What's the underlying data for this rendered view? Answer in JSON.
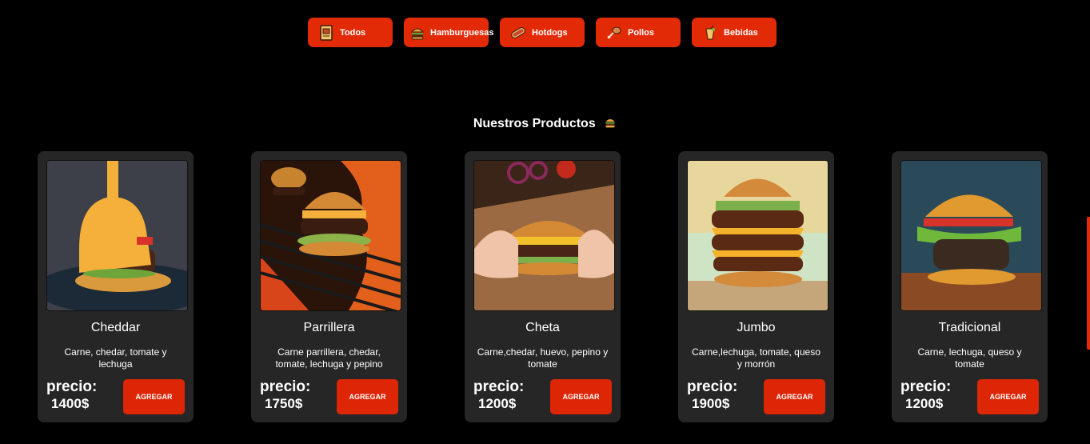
{
  "filters": [
    {
      "label": "Todos",
      "icon": "menu-book-icon"
    },
    {
      "label": "Hamburguesas",
      "icon": "burger-icon"
    },
    {
      "label": "Hotdogs",
      "icon": "hotdog-icon"
    },
    {
      "label": "Pollos",
      "icon": "chicken-leg-icon"
    },
    {
      "label": "Bebidas",
      "icon": "drink-icon"
    }
  ],
  "section": {
    "title": "Nuestros Productos",
    "icon": "burger-icon"
  },
  "products": [
    {
      "name": "Cheddar",
      "description": "Carne, chedar, tomate y lechuga",
      "price_label": "precio:",
      "price": "1400$",
      "button": "AGREGAR",
      "image": "cheddar-burger-image"
    },
    {
      "name": "Parrillera",
      "description": "Carne parrillera, chedar, tomate, lechuga y pepino",
      "price_label": "precio:",
      "price": "1750$",
      "button": "AGREGAR",
      "image": "grilled-burger-image"
    },
    {
      "name": "Cheta",
      "description": "Carne,chedar, huevo, pepino y tomate",
      "price_label": "precio:",
      "price": "1200$",
      "button": "AGREGAR",
      "image": "hands-burger-image"
    },
    {
      "name": "Jumbo",
      "description": "Carne,lechuga, tomate, queso y morrón",
      "price_label": "precio:",
      "price": "1900$",
      "button": "AGREGAR",
      "image": "triple-burger-image"
    },
    {
      "name": "Tradicional",
      "description": "Carne, lechuga, queso y tomate",
      "price_label": "precio:",
      "price": "1200$",
      "button": "AGREGAR",
      "image": "classic-burger-image"
    }
  ],
  "colors": {
    "accent": "#e32a07",
    "card_bg": "#262626",
    "page_bg": "#000000"
  }
}
